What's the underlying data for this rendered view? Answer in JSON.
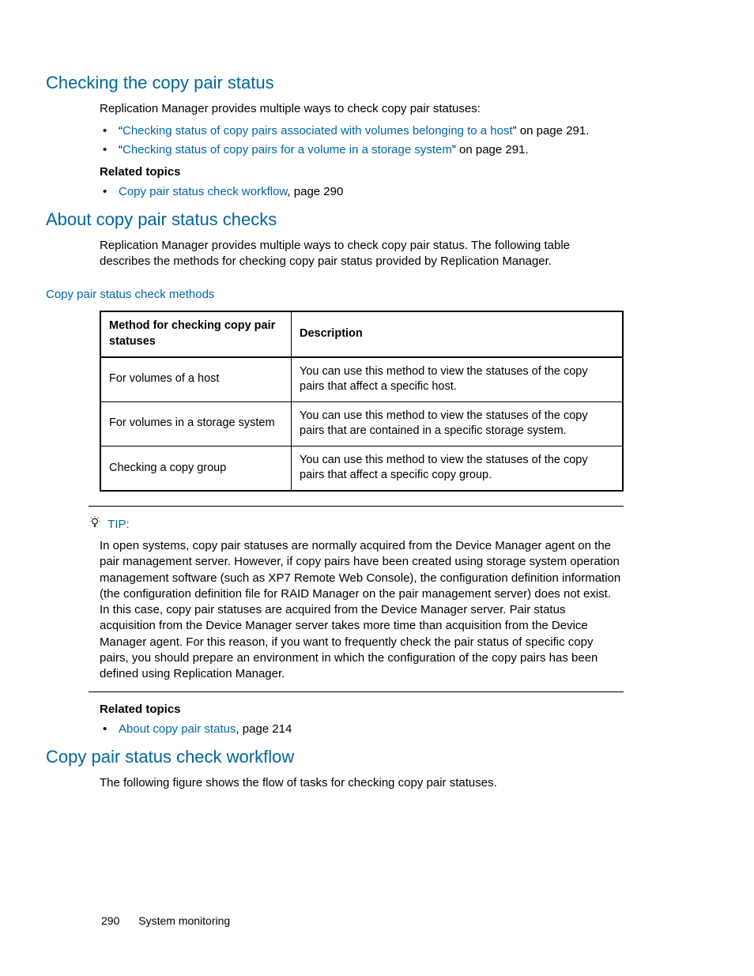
{
  "section1": {
    "heading": "Checking the copy pair status",
    "intro": "Replication Manager provides multiple ways to check copy pair statuses:",
    "items": [
      {
        "prefix": "“",
        "link": "Checking status of copy pairs associated with volumes belonging to a host",
        "suffix": "” on page 291."
      },
      {
        "prefix": "“",
        "link": "Checking status of copy pairs for a volume in a storage system",
        "suffix": "” on page 291."
      }
    ],
    "relatedLabel": "Related topics",
    "related": [
      {
        "link": "Copy pair status check workflow",
        "suffix": ", page 290"
      }
    ]
  },
  "section2": {
    "heading": "About copy pair status checks",
    "intro": "Replication Manager provides multiple ways to check copy pair status. The following table describes the methods for checking copy pair status provided by Replication Manager.",
    "tableCaption": "Copy pair status check methods",
    "table": {
      "headers": [
        "Method for checking copy pair statuses",
        "Description"
      ],
      "rows": [
        [
          "For volumes of a host",
          "You can use this method to view the statuses of the copy pairs that affect a specific host."
        ],
        [
          "For volumes in a storage system",
          "You can use this method to view the statuses of the copy pairs that are contained in a specific storage system."
        ],
        [
          "Checking a copy group",
          "You can use this method to view the statuses of the copy pairs that affect a specific copy group."
        ]
      ]
    },
    "tipLabel": "TIP:",
    "tipBody": "In open systems, copy pair statuses are normally acquired from the Device Manager agent on the pair management server. However, if copy pairs have been created using storage system operation management software (such as XP7 Remote Web Console), the configuration definition information (the configuration definition file for RAID Manager on the pair management server) does not exist. In this case, copy pair statuses are acquired from the Device Manager server. Pair status acquisition from the Device Manager server takes more time than acquisition from the Device Manager agent. For this reason, if you want to frequently check the pair status of specific copy pairs, you should prepare an environment in which the configuration of the copy pairs has been defined using Replication Manager.",
    "relatedLabel": "Related topics",
    "related": [
      {
        "link": "About copy pair status",
        "suffix": ", page 214"
      }
    ]
  },
  "section3": {
    "heading": "Copy pair status check workflow",
    "intro": "The following figure shows the flow of tasks for checking copy pair statuses."
  },
  "footer": {
    "page": "290",
    "title": "System monitoring"
  }
}
